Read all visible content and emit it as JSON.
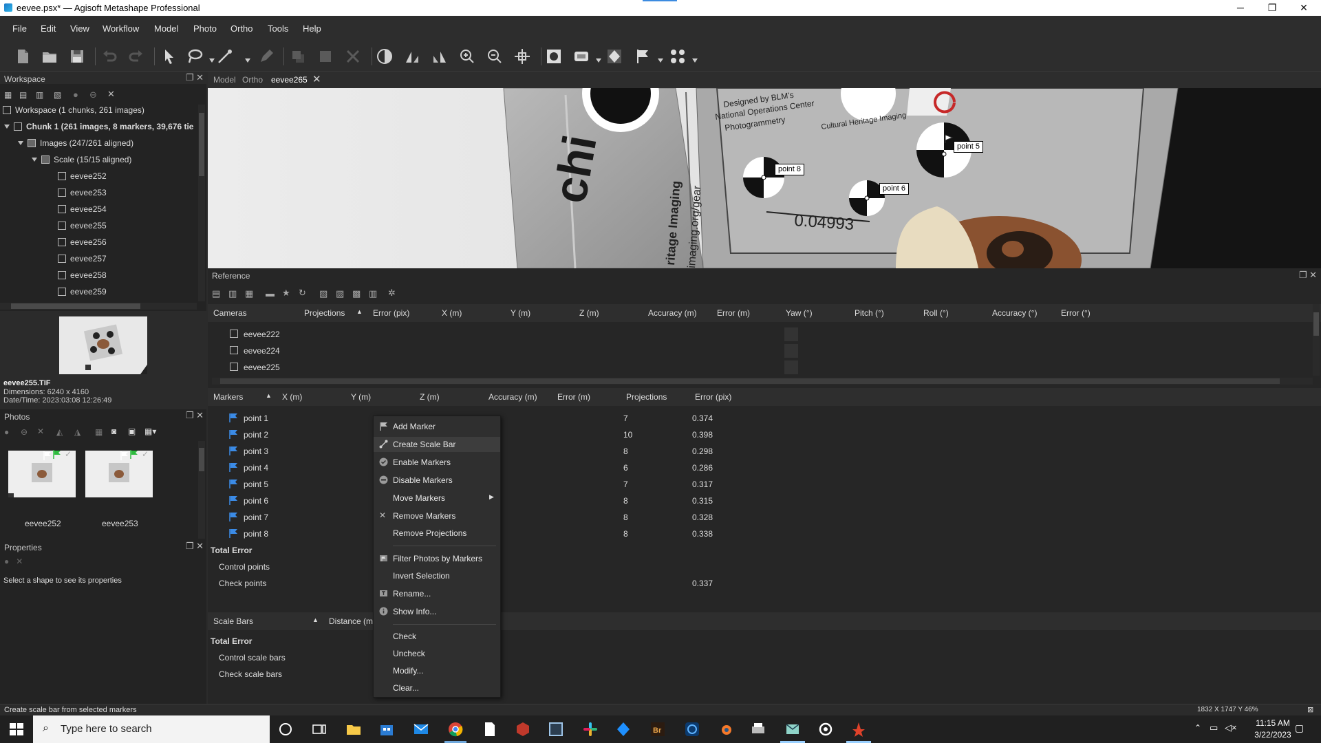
{
  "window": {
    "title": "eevee.psx* — Agisoft Metashape Professional",
    "minimize": "─",
    "restore": "❐",
    "close": "✕"
  },
  "menu": [
    {
      "label": "File"
    },
    {
      "label": "Edit"
    },
    {
      "label": "View"
    },
    {
      "label": "Workflow"
    },
    {
      "label": "Model"
    },
    {
      "label": "Photo"
    },
    {
      "label": "Ortho"
    },
    {
      "label": "Tools"
    },
    {
      "label": "Help"
    }
  ],
  "workspace": {
    "header": "Workspace",
    "root": "Workspace (1 chunks, 261 images)",
    "chunk": "Chunk 1 (261 images, 8 markers, 39,676 tie",
    "images": "Images (247/261 aligned)",
    "scale": "Scale (15/15 aligned)",
    "items": [
      "eevee252",
      "eevee253",
      "eevee254",
      "eevee255",
      "eevee256",
      "eevee257",
      "eevee258",
      "eevee259"
    ]
  },
  "preview": {
    "filename": "eevee255.TIF",
    "dimensions": "Dimensions: 6240 x 4160",
    "datetime": "Date/Time: 2023:03:08 12:26:49"
  },
  "photos": {
    "header": "Photos",
    "items": [
      {
        "label": "eevee252"
      },
      {
        "label": "eevee253"
      }
    ]
  },
  "properties": {
    "header": "Properties",
    "hint": "Select a shape to see its properties"
  },
  "viewer": {
    "tabs": [
      {
        "label": "Model"
      },
      {
        "label": "Ortho"
      },
      {
        "label": "eevee265"
      }
    ],
    "markers": [
      {
        "label": "point 8"
      },
      {
        "label": "point 6"
      },
      {
        "label": "point 5"
      }
    ],
    "scene_text": {
      "chi": "chi",
      "vertical1": "ritage Imaging",
      "vertical2": "imaging.org/gear",
      "designed": "Designed by BLM's",
      "national": "National Operations Center",
      "photogrammetry": "Photogrammetry",
      "cultural": "Cultural Heritage Imaging",
      "scale_value": "0.04993"
    }
  },
  "reference": {
    "header": "Reference",
    "cameras_header": [
      "Cameras",
      "Projections",
      "Error (pix)",
      "X (m)",
      "Y (m)",
      "Z (m)",
      "Accuracy (m)",
      "Error (m)",
      "Yaw (°)",
      "Pitch (°)",
      "Roll (°)",
      "Accuracy (°)",
      "Error (°)"
    ],
    "cameras": [
      {
        "name": "eevee222"
      },
      {
        "name": "eevee224"
      },
      {
        "name": "eevee225"
      }
    ],
    "markers_header": [
      "Markers",
      "X (m)",
      "Y (m)",
      "Z (m)",
      "Accuracy (m)",
      "Error (m)",
      "Projections",
      "Error (pix)"
    ],
    "markers": [
      {
        "name": "point 1",
        "projections": "7",
        "error": "0.374"
      },
      {
        "name": "point 2",
        "projections": "10",
        "error": "0.398"
      },
      {
        "name": "point 3",
        "projections": "8",
        "error": "0.298"
      },
      {
        "name": "point 4",
        "projections": "6",
        "error": "0.286"
      },
      {
        "name": "point 5",
        "projections": "7",
        "error": "0.317"
      },
      {
        "name": "point 6",
        "projections": "8",
        "error": "0.315"
      },
      {
        "name": "point 7",
        "projections": "8",
        "error": "0.328"
      },
      {
        "name": "point 8",
        "projections": "8",
        "error": "0.338"
      }
    ],
    "total_error": "Total Error",
    "control_points": "Control points",
    "check_points": "Check points",
    "check_points_error": "0.337",
    "scalebars_header": [
      "Scale Bars",
      "Distance (m"
    ],
    "control_scale_bars": "Control scale bars",
    "check_scale_bars": "Check scale bars"
  },
  "context_menu": {
    "items": [
      "Add Marker",
      "Create Scale Bar",
      "Enable Markers",
      "Disable Markers",
      "Move Markers",
      "Remove Markers",
      "Remove Projections",
      "Filter Photos by Markers",
      "Invert Selection",
      "Rename...",
      "Show Info...",
      "Check",
      "Uncheck",
      "Modify...",
      "Clear..."
    ]
  },
  "statusbar": {
    "message": "Create scale bar from selected markers",
    "coords": "1832 X  1747 Y  46%"
  },
  "taskbar": {
    "search_placeholder": "Type here to search",
    "time": "11:15 AM",
    "date": "3/22/2023"
  },
  "colors": {
    "panel": "#232323",
    "highlight": "#3d3d3d",
    "flag_blue": "#3b8be6",
    "accent": "#3c8be0"
  }
}
